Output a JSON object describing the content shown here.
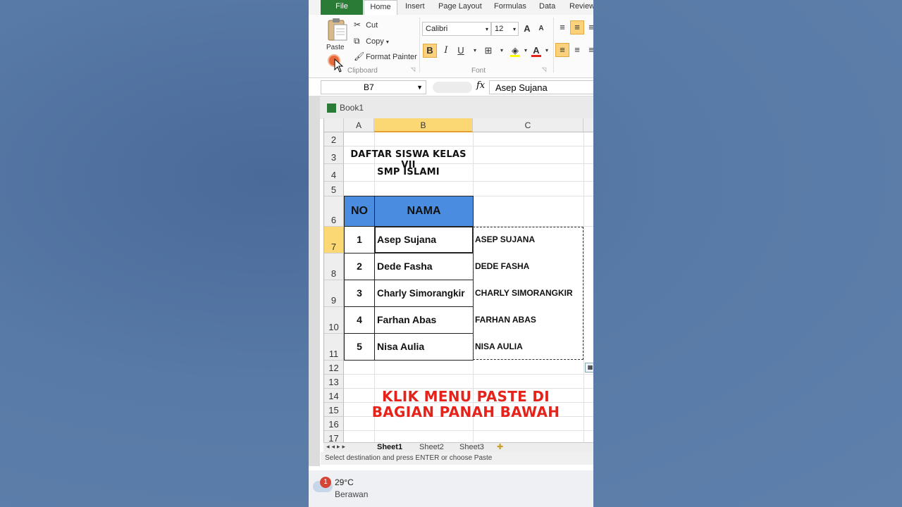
{
  "ribbon": {
    "tabs": [
      "File",
      "Home",
      "Insert",
      "Page Layout",
      "Formulas",
      "Data",
      "Review"
    ],
    "clipboard": {
      "paste_label": "Paste",
      "cut_label": "Cut",
      "copy_label": "Copy",
      "format_painter_label": "Format Painter",
      "group_label": "Clipboard"
    },
    "font": {
      "name": "Calibri",
      "size": "12",
      "group_label": "Font",
      "bold": "B",
      "italic": "I",
      "underline": "U",
      "grow": "A",
      "shrink": "A",
      "fill_color": "#ffff00",
      "font_color": "#e5231b"
    }
  },
  "formula_bar": {
    "name_box": "B7",
    "fx": "fx",
    "value": "Asep Sujana"
  },
  "workbook": {
    "name": "Book1"
  },
  "sheet": {
    "columns": [
      "A",
      "B",
      "C"
    ],
    "rows": [
      "2",
      "3",
      "4",
      "5",
      "6",
      "7",
      "8",
      "9",
      "10",
      "11",
      "12",
      "13",
      "14",
      "15",
      "16",
      "17"
    ],
    "title1": "DAFTAR SISWA KELAS VII",
    "title2": "SMP ISLAMI",
    "header_no": "NO",
    "header_nama": "NAMA",
    "header_color": "#4a8de0",
    "students": [
      {
        "no": "1",
        "nama": "Asep Sujana",
        "upper": "ASEP SUJANA"
      },
      {
        "no": "2",
        "nama": "Dede Fasha",
        "upper": "DEDE FASHA"
      },
      {
        "no": "3",
        "nama": "Charly Simorangkir",
        "upper": "CHARLY SIMORANGKIR"
      },
      {
        "no": "4",
        "nama": "Farhan Abas",
        "upper": "FARHAN ABAS"
      },
      {
        "no": "5",
        "nama": "Nisa Aulia",
        "upper": "NISA AULIA"
      }
    ],
    "caption_line1": "KLIK MENU PASTE DI",
    "caption_line2": "BAGIAN PANAH BAWAH",
    "caption_color": "#e5231b",
    "sheet_tabs": [
      "Sheet1",
      "Sheet2",
      "Sheet3"
    ]
  },
  "status_bar": {
    "message": "Select destination and press ENTER or choose Paste"
  },
  "taskbar": {
    "notification_count": "1",
    "temperature": "29°C",
    "weather": "Berawan"
  }
}
